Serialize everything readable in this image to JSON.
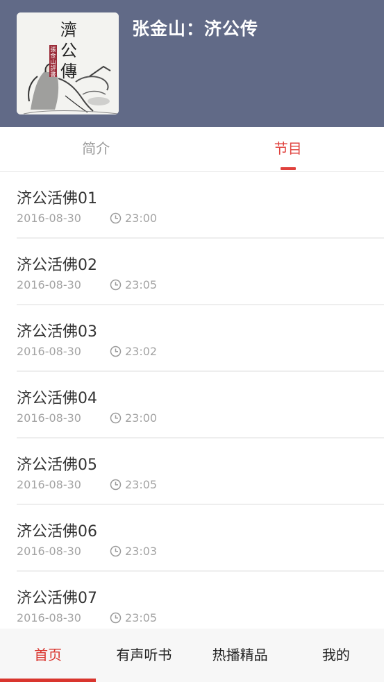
{
  "header": {
    "book_title": "张金山：济公传",
    "cover": {
      "title_chars": [
        "濟",
        "公",
        "傳"
      ],
      "seal_text": "張金山評書"
    }
  },
  "tabs": [
    {
      "label": "简介",
      "active": false
    },
    {
      "label": "节目",
      "active": true
    }
  ],
  "episodes": [
    {
      "title": "济公活佛01",
      "date": "2016-08-30",
      "duration": "23:00"
    },
    {
      "title": "济公活佛02",
      "date": "2016-08-30",
      "duration": "23:05"
    },
    {
      "title": "济公活佛03",
      "date": "2016-08-30",
      "duration": "23:02"
    },
    {
      "title": "济公活佛04",
      "date": "2016-08-30",
      "duration": "23:00"
    },
    {
      "title": "济公活佛05",
      "date": "2016-08-30",
      "duration": "23:05"
    },
    {
      "title": "济公活佛06",
      "date": "2016-08-30",
      "duration": "23:03"
    },
    {
      "title": "济公活佛07",
      "date": "2016-08-30",
      "duration": "23:05"
    }
  ],
  "bottom_nav": [
    {
      "label": "首页",
      "active": true
    },
    {
      "label": "有声听书",
      "active": false
    },
    {
      "label": "热播精品",
      "active": false
    },
    {
      "label": "我的",
      "active": false
    }
  ],
  "colors": {
    "header_bg": "#616a87",
    "accent": "#e0413d",
    "nav_bg": "#f7f7f7",
    "meta_text": "#a3a3a3"
  },
  "icons": {
    "duration": "clock-icon"
  }
}
